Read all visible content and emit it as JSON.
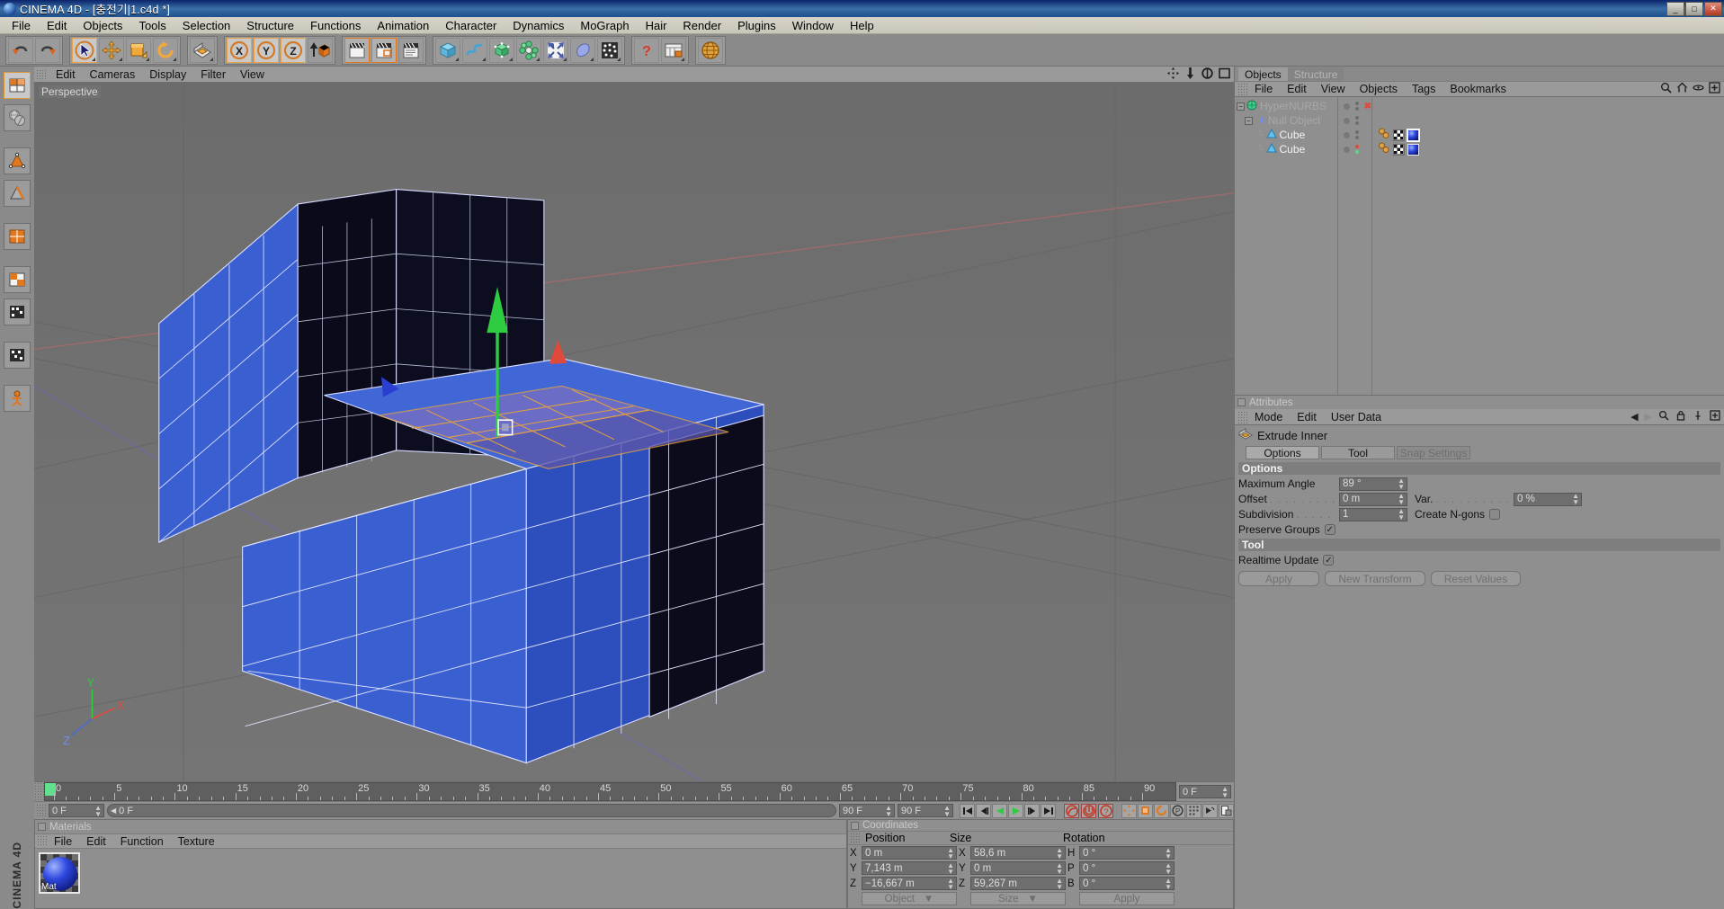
{
  "window": {
    "title": "CINEMA 4D - [충전기|1.c4d *]",
    "app_icon": "c4d-sphere-icon",
    "buttons": {
      "minimize": "_",
      "maximize": "□",
      "close": "✕"
    }
  },
  "menubar": {
    "items": [
      "File",
      "Edit",
      "Objects",
      "Tools",
      "Selection",
      "Structure",
      "Functions",
      "Animation",
      "Character",
      "Dynamics",
      "MoGraph",
      "Hair",
      "Render",
      "Plugins",
      "Window",
      "Help"
    ]
  },
  "toolbar": {
    "groups": [
      {
        "name": "undo-redo",
        "icons": [
          {
            "name": "undo-icon",
            "label": "Undo"
          },
          {
            "name": "redo-icon",
            "label": "Redo"
          }
        ]
      },
      {
        "name": "transform-tools",
        "icons": [
          {
            "name": "select-cursor-icon",
            "label": "Live Selection"
          },
          {
            "name": "move-icon",
            "label": "Move"
          },
          {
            "name": "scale-icon",
            "label": "Scale"
          },
          {
            "name": "rotate-icon",
            "label": "Rotate"
          }
        ]
      },
      {
        "name": "object-axis",
        "icons": [
          {
            "name": "object-axis-icon",
            "label": "Object/World Coordinate"
          }
        ]
      },
      {
        "name": "axis-locks",
        "icons": [
          {
            "name": "lock-x-icon",
            "label": "X"
          },
          {
            "name": "lock-y-icon",
            "label": "Y"
          },
          {
            "name": "lock-z-icon",
            "label": "Z"
          },
          {
            "name": "world-object-icon",
            "label": "World/Object"
          }
        ]
      },
      {
        "name": "render-tools",
        "icons": [
          {
            "name": "render-view-icon",
            "label": "Render View"
          },
          {
            "name": "render-region-icon",
            "label": "Render Region"
          },
          {
            "name": "render-settings-icon",
            "label": "Render Settings"
          }
        ]
      },
      {
        "name": "primitives",
        "icons": [
          {
            "name": "cube-primitive-icon",
            "label": "Cube"
          },
          {
            "name": "spline-icon",
            "label": "Spline"
          },
          {
            "name": "nurbs-icon",
            "label": "HyperNURBS"
          },
          {
            "name": "array-icon",
            "label": "Array"
          },
          {
            "name": "deformer-icon",
            "label": "Deformer"
          },
          {
            "name": "scene-icon",
            "label": "Scene"
          },
          {
            "name": "particles-icon",
            "label": "Particles"
          }
        ]
      },
      {
        "name": "help-group",
        "icons": [
          {
            "name": "help-icon",
            "label": "Help"
          },
          {
            "name": "layout-icon",
            "label": "Layout"
          }
        ]
      },
      {
        "name": "globe-group",
        "icons": [
          {
            "name": "globe-icon",
            "label": "Content Browser"
          }
        ]
      }
    ]
  },
  "leftbar": {
    "label": "CINEMA 4D",
    "tools": [
      {
        "name": "model-mode-icon",
        "label": "Model"
      },
      {
        "name": "texture-mode-icon",
        "label": "Texture"
      },
      {
        "name": "point-mode-icon",
        "label": "Points"
      },
      {
        "name": "edge-mode-icon",
        "label": "Edges"
      },
      {
        "name": "polygon-mode-icon",
        "label": "Polygons"
      },
      {
        "name": "enable-axis-icon",
        "label": "Enable Axis Modification"
      },
      {
        "name": "object-axis-mode-icon",
        "label": "Object Axis"
      },
      {
        "name": "viewport-solo-icon",
        "label": "Viewport Solo"
      },
      {
        "name": "animation-mode-icon",
        "label": "Animation"
      }
    ]
  },
  "viewport": {
    "menu": [
      "Edit",
      "Cameras",
      "Display",
      "Filter",
      "View"
    ],
    "camera_label": "Perspective",
    "corner_icons": [
      "pan-icon",
      "dolly-icon",
      "rotate-view-icon",
      "maximize-view-icon"
    ],
    "axis_gizmo": {
      "x": "X",
      "y": "Y",
      "z": "Z"
    }
  },
  "timeline": {
    "ticks": [
      "0",
      "5",
      "10",
      "15",
      "20",
      "25",
      "30",
      "35",
      "40",
      "45",
      "50",
      "55",
      "60",
      "65",
      "70",
      "75",
      "80",
      "85",
      "90"
    ],
    "current_frame_right": "0 F",
    "current_frame_field": "0 F",
    "range_field": "0 F",
    "start_field": "90 F",
    "end_field": "90 F",
    "transport": [
      {
        "name": "go-to-start-icon",
        "glyph": "⏮"
      },
      {
        "name": "step-back-icon",
        "glyph": "◁|"
      },
      {
        "name": "play-back-icon",
        "glyph": "◀"
      },
      {
        "name": "play-forward-icon",
        "glyph": "▶"
      },
      {
        "name": "step-forward-icon",
        "glyph": "|▷"
      },
      {
        "name": "go-to-end-icon",
        "glyph": "⏭"
      }
    ],
    "record_buttons": [
      {
        "name": "record-active-objects-icon"
      },
      {
        "name": "autokeying-icon"
      },
      {
        "name": "keyframe-selection-icon"
      }
    ],
    "key_mode_buttons": [
      {
        "name": "position-key-icon"
      },
      {
        "name": "scale-key-icon"
      },
      {
        "name": "rotation-key-icon"
      },
      {
        "name": "param-key-icon"
      },
      {
        "name": "point-level-anim-icon"
      },
      {
        "name": "pla-key-icon"
      },
      {
        "name": "keyframe-doc-icon"
      }
    ]
  },
  "materials": {
    "title": "Materials",
    "menu": [
      "File",
      "Edit",
      "Function",
      "Texture"
    ],
    "items": [
      {
        "name": "Mat",
        "selected": true,
        "color": "#2f48e0"
      }
    ]
  },
  "coordinates": {
    "title": "Coordinates",
    "columns": [
      "Position",
      "Size",
      "Rotation"
    ],
    "rows": [
      {
        "pos_axis": "X",
        "pos_value": "0 m",
        "size_axis": "X",
        "size_value": "58,6 m",
        "rot_axis": "H",
        "rot_value": "0 °"
      },
      {
        "pos_axis": "Y",
        "pos_value": "7,143 m",
        "size_axis": "Y",
        "size_value": "0 m",
        "rot_axis": "P",
        "rot_value": "0 °"
      },
      {
        "pos_axis": "Z",
        "pos_value": "−16,667 m",
        "size_axis": "Z",
        "size_value": "59,267 m",
        "rot_axis": "B",
        "rot_value": "0 °"
      }
    ],
    "buttons": {
      "object": "Object",
      "size": "Size",
      "apply": "Apply"
    }
  },
  "objects_panel": {
    "tabs": [
      {
        "label": "Objects",
        "active": true
      },
      {
        "label": "Structure",
        "active": false
      }
    ],
    "menu": [
      "File",
      "Edit",
      "View",
      "Objects",
      "Tags",
      "Bookmarks"
    ],
    "header_icons": [
      "search-icon",
      "home-icon",
      "eye-icon",
      "add-icon"
    ],
    "tree": [
      {
        "name": "HyperNURBS",
        "icon": "hypernurbs-icon",
        "depth": 0,
        "expander": "−",
        "dim": true,
        "tags": [],
        "marker": "x-red"
      },
      {
        "name": "Null Object",
        "icon": "null-object-icon",
        "depth": 1,
        "expander": "−",
        "dim": true,
        "tags": []
      },
      {
        "name": "Cube",
        "icon": "cube-icon",
        "depth": 2,
        "expander": "",
        "dim": false,
        "tags": [
          "phong-tag",
          "texture-tag",
          "material-tag"
        ],
        "selected_tag": 2
      },
      {
        "name": "Cube",
        "icon": "cube-icon",
        "depth": 2,
        "expander": "",
        "dim": false,
        "tags": [
          "phong-tag",
          "texture-tag",
          "material-tag"
        ]
      }
    ]
  },
  "attributes_panel": {
    "title": "Attributes",
    "menu": [
      "Mode",
      "Edit",
      "User Data"
    ],
    "nav_icons": [
      "prev-icon",
      "next-icon",
      "search-icon",
      "lock-icon",
      "pin-icon",
      "expand-icon"
    ],
    "object": {
      "name": "Extrude Inner",
      "icon": "extrude-inner-icon"
    },
    "tabs": [
      {
        "label": "Options",
        "state": "on"
      },
      {
        "label": "Tool",
        "state": "off"
      },
      {
        "label": "Snap Settings",
        "state": "disabled"
      }
    ],
    "sections": [
      {
        "title": "Options",
        "fields": [
          {
            "label": "Maximum Angle",
            "dots": "",
            "value": "89 °",
            "type": "number"
          },
          {
            "label": "Offset",
            "dots": ". . . . . . . . .",
            "value": "0 m",
            "type": "number",
            "extra_label": "Var.",
            "extra_dots": ". . . . . . . . . . .",
            "extra_value": "0 %"
          },
          {
            "label": "Subdivision",
            "dots": ". . . . .",
            "value": "1",
            "type": "number",
            "extra_label": "Create N-gons",
            "extra_checked": false,
            "extra_type": "checkbox"
          },
          {
            "label": "Preserve Groups",
            "dots": "",
            "value": "",
            "type": "checkbox",
            "checked": true
          }
        ]
      },
      {
        "title": "Tool",
        "fields": [
          {
            "label": "Realtime Update",
            "dots": "",
            "value": "",
            "type": "checkbox",
            "checked": true
          }
        ],
        "buttons": [
          "Apply",
          "New Transform",
          "Reset Values"
        ]
      }
    ]
  },
  "colors": {
    "chrome": "#8a8a8a",
    "panel": "#8f8f8f",
    "field": "#6e6e6e",
    "viewport_bg": "#6f6f6f",
    "accent_orange": "#e07820",
    "mesh_blue": "#3a5fd0",
    "axis_green": "#2ecc40",
    "axis_red": "#e04a3a",
    "title_blue": "#0a246a"
  }
}
